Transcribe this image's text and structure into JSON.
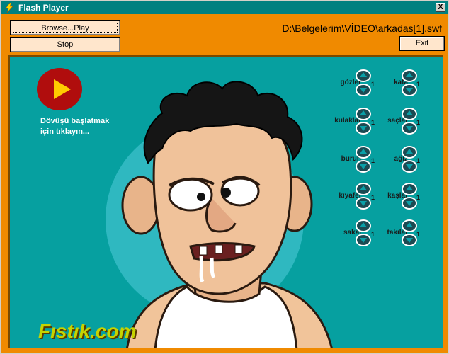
{
  "window": {
    "title": "Flash Player",
    "close_label": "X"
  },
  "toolbar": {
    "browse_label": "Browse...Play",
    "stop_label": "Stop",
    "exit_label": "Exit",
    "file_path": "D:\\Belgelerim\\VİDEO\\arkadas[1].swf"
  },
  "content": {
    "start_text": "Dövüşü başlatmak için tıklayın...",
    "logo_text": "Fıstık.com",
    "controls_left": [
      {
        "label": "gözler",
        "value": "1"
      },
      {
        "label": "kulaklar",
        "value": "1"
      },
      {
        "label": "burun",
        "value": "1"
      },
      {
        "label": "kıyafet",
        "value": "1"
      },
      {
        "label": "sakal",
        "value": "1"
      }
    ],
    "controls_right": [
      {
        "label": "kafa",
        "value": "1"
      },
      {
        "label": "saçlar",
        "value": "1"
      },
      {
        "label": "ağız",
        "value": "1"
      },
      {
        "label": "kaşlar",
        "value": "1"
      },
      {
        "label": "takılar",
        "value": "1"
      }
    ],
    "colors": {
      "accent": "#f08a00",
      "stage": "#06a0a0",
      "titlebar": "#008080"
    }
  }
}
